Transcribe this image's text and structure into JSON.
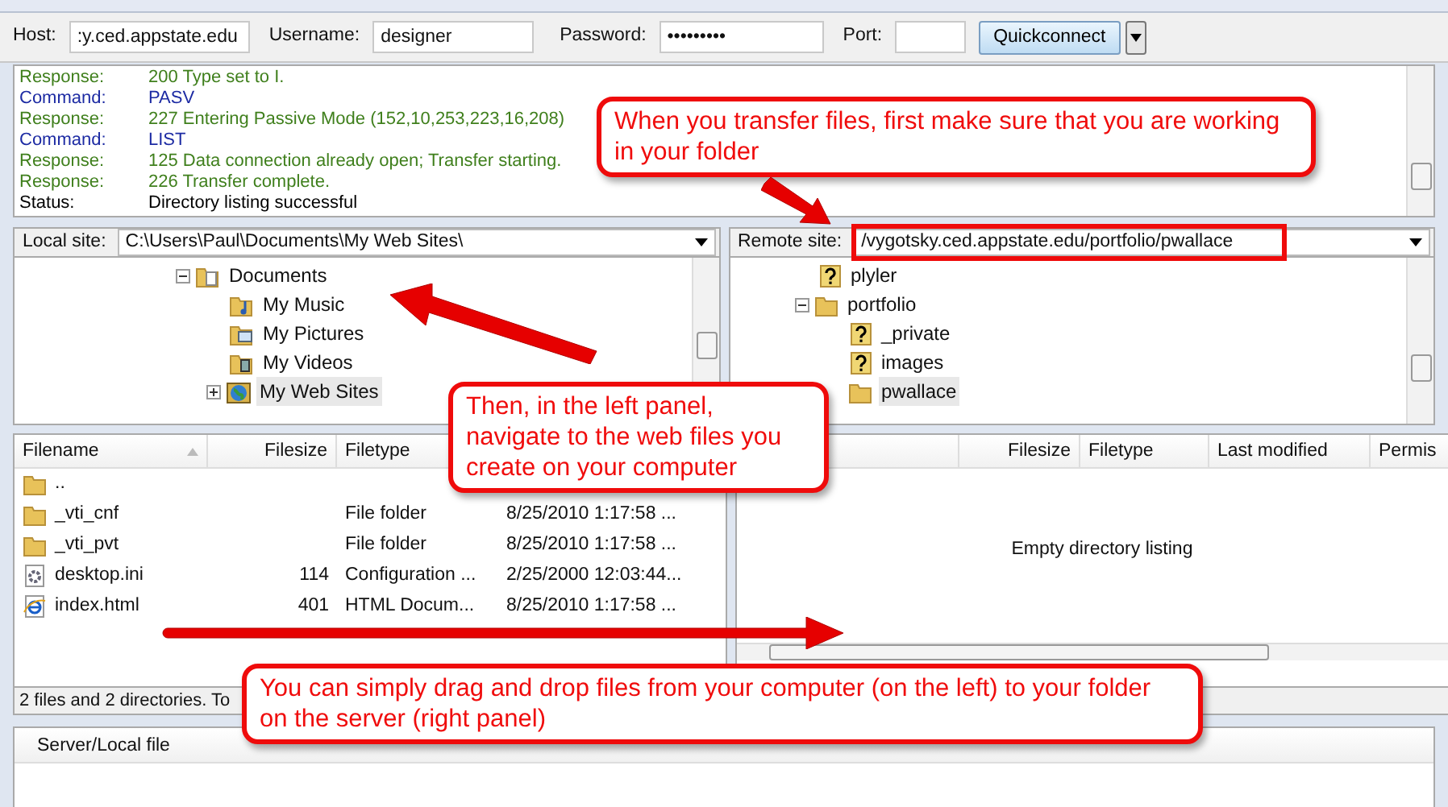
{
  "quickconnect": {
    "host_label": "Host:",
    "host": ":y.ced.appstate.edu",
    "username_label": "Username:",
    "username": "designer",
    "password_label": "Password:",
    "password": "•••••••••",
    "port_label": "Port:",
    "button": "Quickconnect"
  },
  "log": [
    {
      "kind": "response",
      "label": "Response:",
      "text": "200 Type set to I."
    },
    {
      "kind": "command",
      "label": "Command:",
      "text": "PASV"
    },
    {
      "kind": "response",
      "label": "Response:",
      "text": "227 Entering Passive Mode (152,10,253,223,16,208)"
    },
    {
      "kind": "command",
      "label": "Command:",
      "text": "LIST"
    },
    {
      "kind": "response",
      "label": "Response:",
      "text": "125 Data connection already open; Transfer starting."
    },
    {
      "kind": "response",
      "label": "Response:",
      "text": "226 Transfer complete."
    },
    {
      "kind": "status",
      "label": "Status:",
      "text": "Directory listing successful"
    }
  ],
  "local_site": {
    "label": "Local site:",
    "path": "C:\\Users\\Paul\\Documents\\My Web Sites\\",
    "tree": [
      {
        "label": "Documents",
        "kind": "documents",
        "expanded": true,
        "selected": false,
        "children": [
          {
            "label": "My Music",
            "kind": "music",
            "selected": false
          },
          {
            "label": "My Pictures",
            "kind": "pictures",
            "selected": false
          },
          {
            "label": "My Videos",
            "kind": "videos",
            "selected": false
          },
          {
            "label": "My Web Sites",
            "kind": "globe",
            "expanded": false,
            "selected": true
          }
        ]
      }
    ]
  },
  "remote_site": {
    "label": "Remote site:",
    "path": "/vygotsky.ced.appstate.edu/portfolio/pwallace",
    "tree": [
      {
        "label": "plyler",
        "kind": "unknown",
        "selected": false
      },
      {
        "label": "portfolio",
        "kind": "folder",
        "expanded": true,
        "selected": false,
        "children": [
          {
            "label": "_private",
            "kind": "unknown",
            "selected": false
          },
          {
            "label": "images",
            "kind": "unknown",
            "selected": false
          },
          {
            "label": "pwallace",
            "kind": "folder",
            "selected": true
          }
        ]
      }
    ]
  },
  "local_files": {
    "columns": [
      "Filename",
      "Filesize",
      "Filetype"
    ],
    "rows": [
      {
        "kind": "folder",
        "name": ".."
      },
      {
        "kind": "folder",
        "name": "_vti_cnf",
        "type": "File folder",
        "modified": "8/25/2010 1:17:58 ..."
      },
      {
        "kind": "folder",
        "name": "_vti_pvt",
        "type": "File folder",
        "modified": "8/25/2010 1:17:58 ..."
      },
      {
        "kind": "settings",
        "name": "desktop.ini",
        "size": "114",
        "type": "Configuration ...",
        "modified": "2/25/2000 12:03:44..."
      },
      {
        "kind": "web",
        "name": "index.html",
        "size": "401",
        "type": "HTML Docum...",
        "modified": "8/25/2010 1:17:58 ..."
      }
    ],
    "status": "2 files and 2 directories. To"
  },
  "remote_files": {
    "columns": [
      "Filesize",
      "Filetype",
      "Last modified",
      "Permis"
    ],
    "message": "Empty directory listing"
  },
  "queue": {
    "columns": [
      "Server/Local file"
    ]
  },
  "callouts": [
    {
      "text": "When you transfer files, first make sure that you are working in your folder"
    },
    {
      "text": "Then, in the left panel, navigate to the web files you create on your computer"
    },
    {
      "text": "You can simply drag and drop files from your computer (on the left) to your folder on the server (right panel)"
    }
  ]
}
